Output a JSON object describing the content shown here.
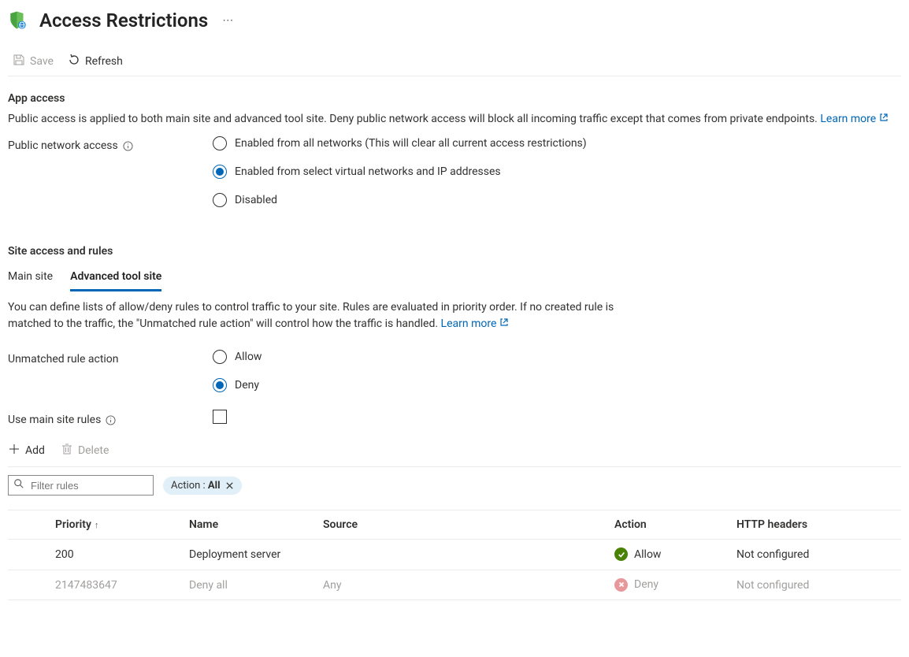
{
  "header": {
    "title": "Access Restrictions",
    "more_aria": "More"
  },
  "toolbar": {
    "save": "Save",
    "refresh": "Refresh"
  },
  "app_access": {
    "heading": "App access",
    "description": "Public access is applied to both main site and advanced tool site. Deny public network access will block all incoming traffic except that comes from private endpoints.",
    "learn_more": "Learn more",
    "public_network_label": "Public network access",
    "options": {
      "enabled_all": "Enabled from all networks (This will clear all current access restrictions)",
      "enabled_select": "Enabled from select virtual networks and IP addresses",
      "disabled": "Disabled"
    }
  },
  "site_access": {
    "heading": "Site access and rules",
    "tabs": {
      "main": "Main site",
      "advanced": "Advanced tool site"
    },
    "description": "You can define lists of allow/deny rules to control traffic to your site. Rules are evaluated in priority order. If no created rule is matched to the traffic, the \"Unmatched rule action\" will control how the traffic is handled.",
    "learn_more": "Learn more",
    "unmatched_label": "Unmatched rule action",
    "unmatched_options": {
      "allow": "Allow",
      "deny": "Deny"
    },
    "use_main_label": "Use main site rules"
  },
  "rules_toolbar": {
    "add": "Add",
    "delete": "Delete"
  },
  "filter": {
    "placeholder": "Filter rules",
    "pill_key": "Action : ",
    "pill_value": "All"
  },
  "table": {
    "headers": {
      "priority": "Priority",
      "name": "Name",
      "source": "Source",
      "action": "Action",
      "http": "HTTP headers"
    },
    "rows": [
      {
        "priority": "200",
        "name": "Deployment server",
        "source": "",
        "action_type": "Allow",
        "action_label": "Allow",
        "http": "Not configured",
        "muted": false
      },
      {
        "priority": "2147483647",
        "name": "Deny all",
        "source": "Any",
        "action_type": "Deny",
        "action_label": "Deny",
        "http": "Not configured",
        "muted": true
      }
    ]
  }
}
